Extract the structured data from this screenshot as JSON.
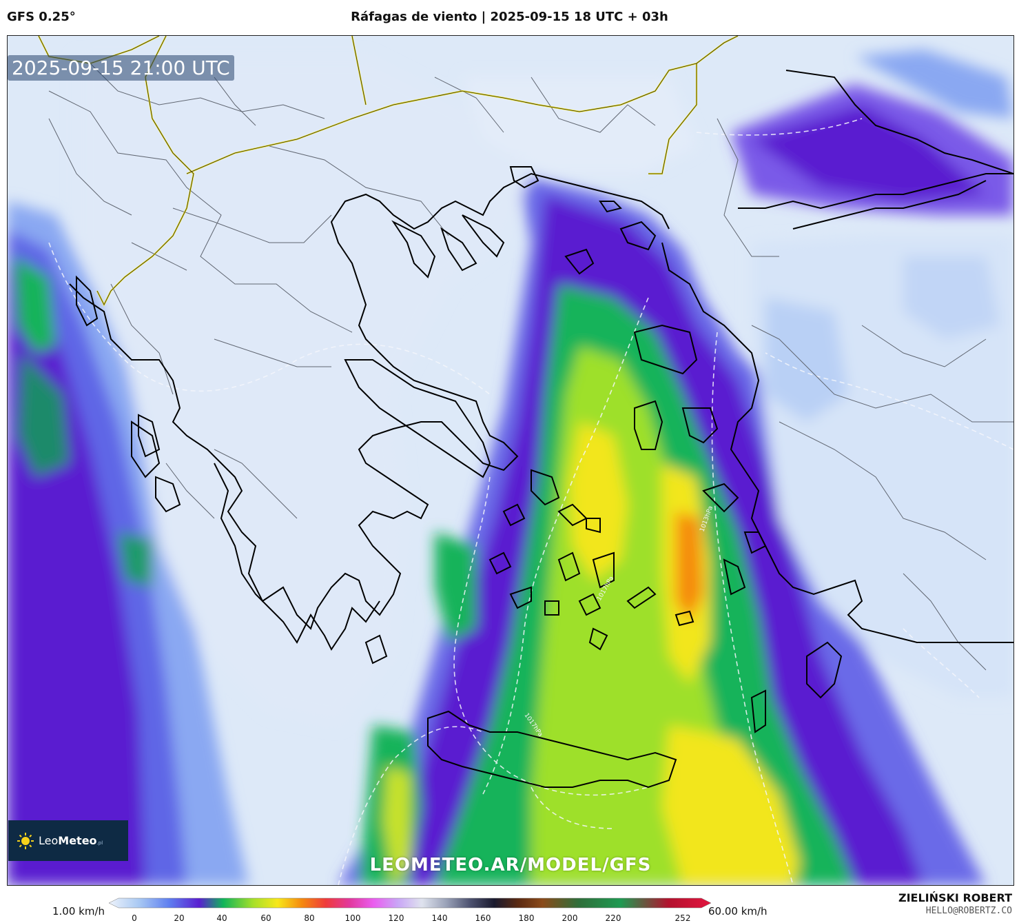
{
  "header": {
    "model": "GFS 0.25°",
    "title": "Ráfagas de viento | 2025-09-15 18 UTC + 03h"
  },
  "map": {
    "valid_time": "2025-09-15 21:00 UTC",
    "watermark": "LEOMETEO.AR/MODEL/GFS",
    "logo": {
      "name_light": "Leo",
      "name_bold": "Meteo",
      "suffix": ".pl"
    },
    "isobar_labels": [
      "1017hPa",
      "1013hPa",
      "1017hPa"
    ]
  },
  "colorbar": {
    "min_label": "1.00 km/h",
    "max_label": "60.00 km/h",
    "ticks": [
      "0",
      "20",
      "40",
      "60",
      "80",
      "100",
      "120",
      "140",
      "160",
      "180",
      "200",
      "220",
      "252"
    ],
    "colors": [
      "#dde9f8",
      "#a9c9f3",
      "#5f7ff0",
      "#5a1fd0",
      "#11b55a",
      "#a7e02a",
      "#f7e81b",
      "#f58a0f",
      "#ef3b3b",
      "#e2389e",
      "#ea5ef0",
      "#c9a6f6",
      "#dfe3ee",
      "#9aa2b8",
      "#4d5270",
      "#1a1a2e",
      "#5b2a12",
      "#8a4a1a",
      "#2f6e3a",
      "#1f9a52",
      "#b3122e",
      "#e3153f"
    ]
  },
  "credits": {
    "author": "ZIELIŃSKI ROBERT",
    "email": "HELLO@ROBERTZ.CO"
  }
}
